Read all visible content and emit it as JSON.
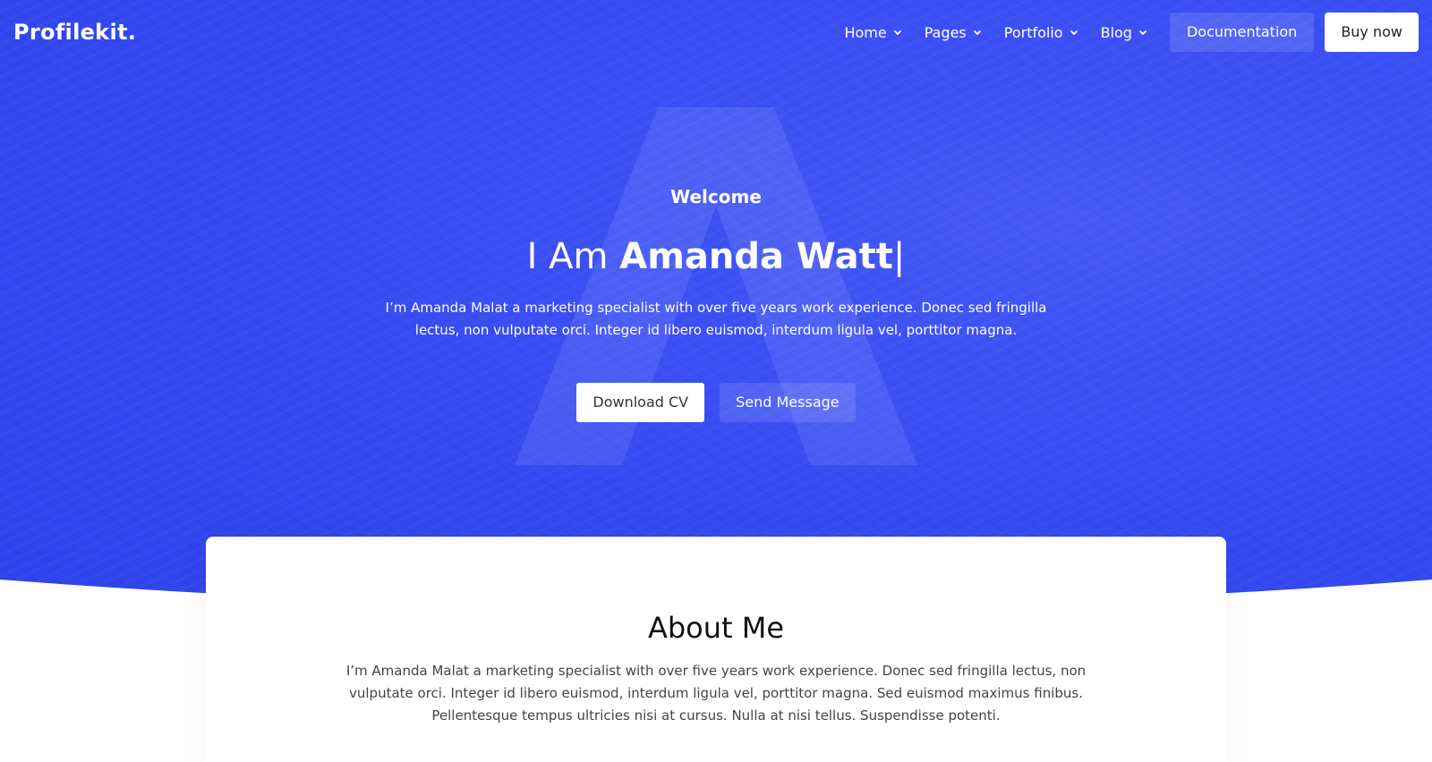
{
  "brand": {
    "logo": "Profilekit."
  },
  "nav": {
    "items": [
      {
        "label": "Home"
      },
      {
        "label": "Pages"
      },
      {
        "label": "Portfolio"
      },
      {
        "label": "Blog"
      }
    ],
    "documentation_label": "Documentation",
    "buy_label": "Buy now"
  },
  "hero": {
    "welcome": "Welcome",
    "headline_prefix": "I Am ",
    "headline_name": "Amanda Watt",
    "headline_cursor": "|",
    "description": "I’m Amanda Malat a marketing specialist with over five years work experience. Donec sed fringilla lectus, non vulputate orci. Integer id libero euismod, interdum ligula vel, porttitor magna.",
    "download_label": "Download CV",
    "message_label": "Send Message",
    "background_color": "#3a4ff4",
    "watermark_letter": "A"
  },
  "about": {
    "title": "About Me",
    "text": "I’m Amanda Malat a marketing specialist with over five years work experience. Donec sed fringilla lectus, non vulputate orci. Integer id libero euismod, interdum ligula vel, porttitor magna. Sed euismod maximus finibus. Pellentesque tempus ultricies nisi at cursus. Nulla at nisi tellus. Suspendisse potenti."
  },
  "icons": {
    "nav_dropdown": "chevron-down-icon"
  }
}
